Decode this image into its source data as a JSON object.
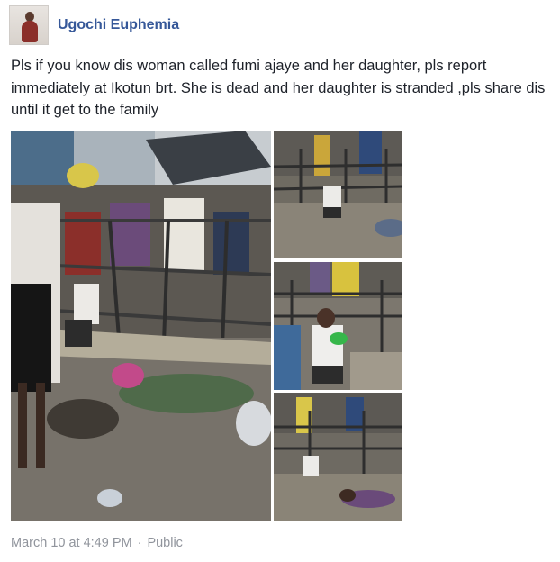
{
  "post": {
    "author": "Ugochi Euphemia",
    "text_line1": "Pls if you know dis woman called fumi ajaye and her daughter, pls report",
    "text_line2": "immediately at Ikotun brt. She is dead and her daughter is stranded ,pls share dis",
    "text_line3": "until it get to the family",
    "timestamp": "March 10 at 4:49 PM",
    "separator": "·",
    "privacy": "Public"
  },
  "icons": {
    "avatar": "profile-photo",
    "photos": [
      "photo-main",
      "photo-thumb-1",
      "photo-thumb-2",
      "photo-thumb-3"
    ]
  },
  "colors": {
    "author": "#365899",
    "text": "#1d2129",
    "meta": "#90949c"
  }
}
